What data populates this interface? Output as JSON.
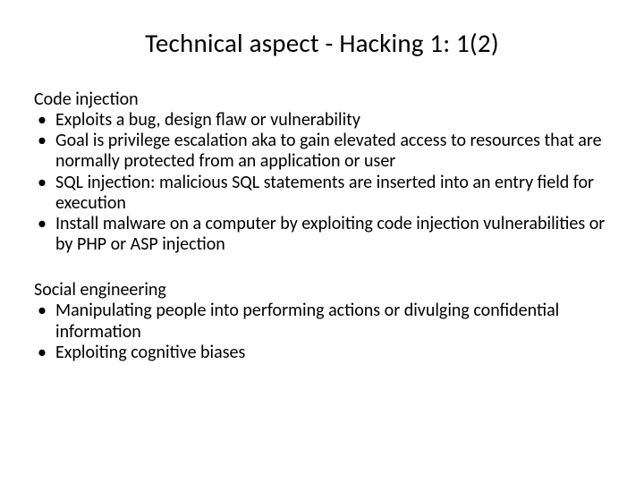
{
  "title": "Technical aspect - Hacking 1: 1(2)",
  "section1": {
    "heading": "Code injection",
    "items": [
      "Exploits a bug, design flaw or vulnerability",
      "Goal is privilege escalation aka to gain elevated access to resources that are normally protected from an application or user",
      "SQL injection: malicious SQL statements are inserted into an entry field for execution",
      "Install malware on a computer by exploiting code injection vulnerabilities or by PHP or ASP injection"
    ]
  },
  "section2": {
    "heading": "Social engineering",
    "items": [
      "Manipulating people into performing actions or divulging confidential information",
      "Exploiting cognitive biases"
    ]
  }
}
